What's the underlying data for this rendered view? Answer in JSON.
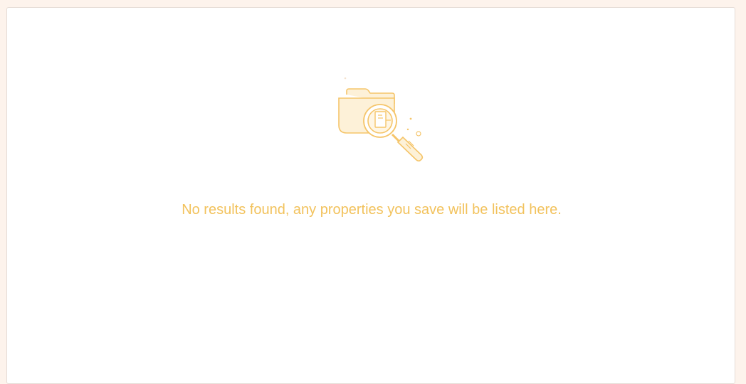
{
  "empty_state": {
    "message": "No results found, any properties you save will be listed here.",
    "icon": "folder-search-icon"
  },
  "colors": {
    "page_background": "#fdf3ec",
    "panel_background": "#ffffff",
    "accent": "#f2c25c",
    "icon_fill": "#fdf1d8",
    "icon_stroke": "#f5c56a"
  }
}
